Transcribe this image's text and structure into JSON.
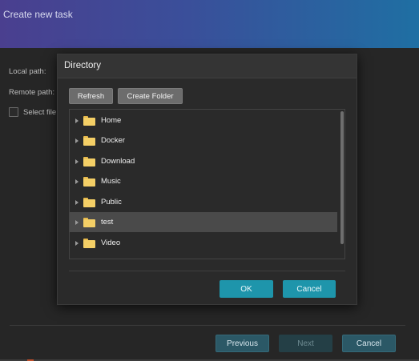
{
  "wizard": {
    "title": "Create new task",
    "local_path_label": "Local path:",
    "remote_path_label": "Remote path:",
    "select_files_label": "Select file",
    "previous_label": "Previous",
    "next_label": "Next",
    "cancel_label": "Cancel"
  },
  "dialog": {
    "title": "Directory",
    "refresh_label": "Refresh",
    "create_folder_label": "Create Folder",
    "folders": [
      {
        "name": "Home",
        "selected": false
      },
      {
        "name": "Docker",
        "selected": false
      },
      {
        "name": "Download",
        "selected": false
      },
      {
        "name": "Music",
        "selected": false
      },
      {
        "name": "Public",
        "selected": false
      },
      {
        "name": "test",
        "selected": true
      },
      {
        "name": "Video",
        "selected": false
      }
    ],
    "ok_label": "OK",
    "cancel_label": "Cancel"
  },
  "colors": {
    "accent": "#1e95ab",
    "folder": "#f4cf66",
    "header_gradient_start": "#4a3f8f",
    "header_gradient_end": "#1f6fa3"
  }
}
